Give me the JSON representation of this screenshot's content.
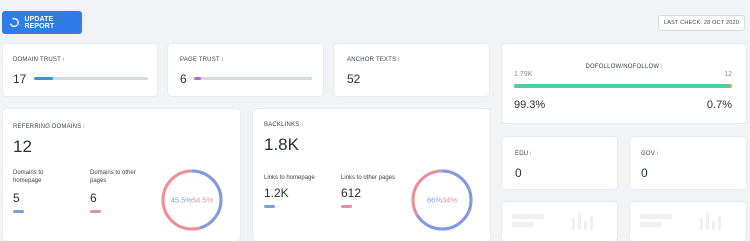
{
  "header": {
    "update_button": "UPDATE REPORT",
    "last_check": "LAST CHECK: 28 OCT 2020"
  },
  "domain_trust": {
    "label": "DOMAIN TRUST",
    "info": "i",
    "value": "17",
    "level": 0.17,
    "color": "#2b9bd8"
  },
  "page_trust": {
    "label": "PAGE TRUST",
    "info": "i",
    "value": "6",
    "level": 0.06,
    "color": "#b86ad0"
  },
  "anchor_texts": {
    "label": "ANCHOR TEXTS",
    "info": "i",
    "value": "52"
  },
  "dofollow": {
    "label": "DOFOLLOW/NOFOLLOW",
    "info": "i",
    "dofollow_count": "1.79K",
    "nofollow_count": "12",
    "dofollow_pct": "99.3%",
    "nofollow_pct": "0.7%",
    "level": 0.993,
    "dofollow_color": "#4ccf9a",
    "nofollow_color": "#f2a03a"
  },
  "referring_domains": {
    "label": "REFERRING DOMAINS",
    "info": "i",
    "value": "12",
    "to_homepage_label": "Domains to homepage",
    "to_homepage_value": "5",
    "to_other_label": "Domains to other pages",
    "to_other_value": "6",
    "donut_pct_a": "45.5%",
    "donut_pct_b": "54.5%",
    "share_a": 0.455,
    "color_a": "#7f9be6",
    "color_b": "#ef8d97"
  },
  "backlinks": {
    "label": "BACKLINKS",
    "info": "i",
    "value": "1.8K",
    "to_homepage_label": "Links to homepage",
    "to_homepage_value": "1.2K",
    "to_other_label": "Links to other pages",
    "to_other_value": "612",
    "donut_pct_a": "66%",
    "donut_pct_b": "34%",
    "share_a": 0.66,
    "color_a": "#7f9be6",
    "color_b": "#ef8d97"
  },
  "edu": {
    "label": "EDU",
    "info": "i",
    "value": "0"
  },
  "gov": {
    "label": "GOV",
    "info": "i",
    "value": "0"
  }
}
